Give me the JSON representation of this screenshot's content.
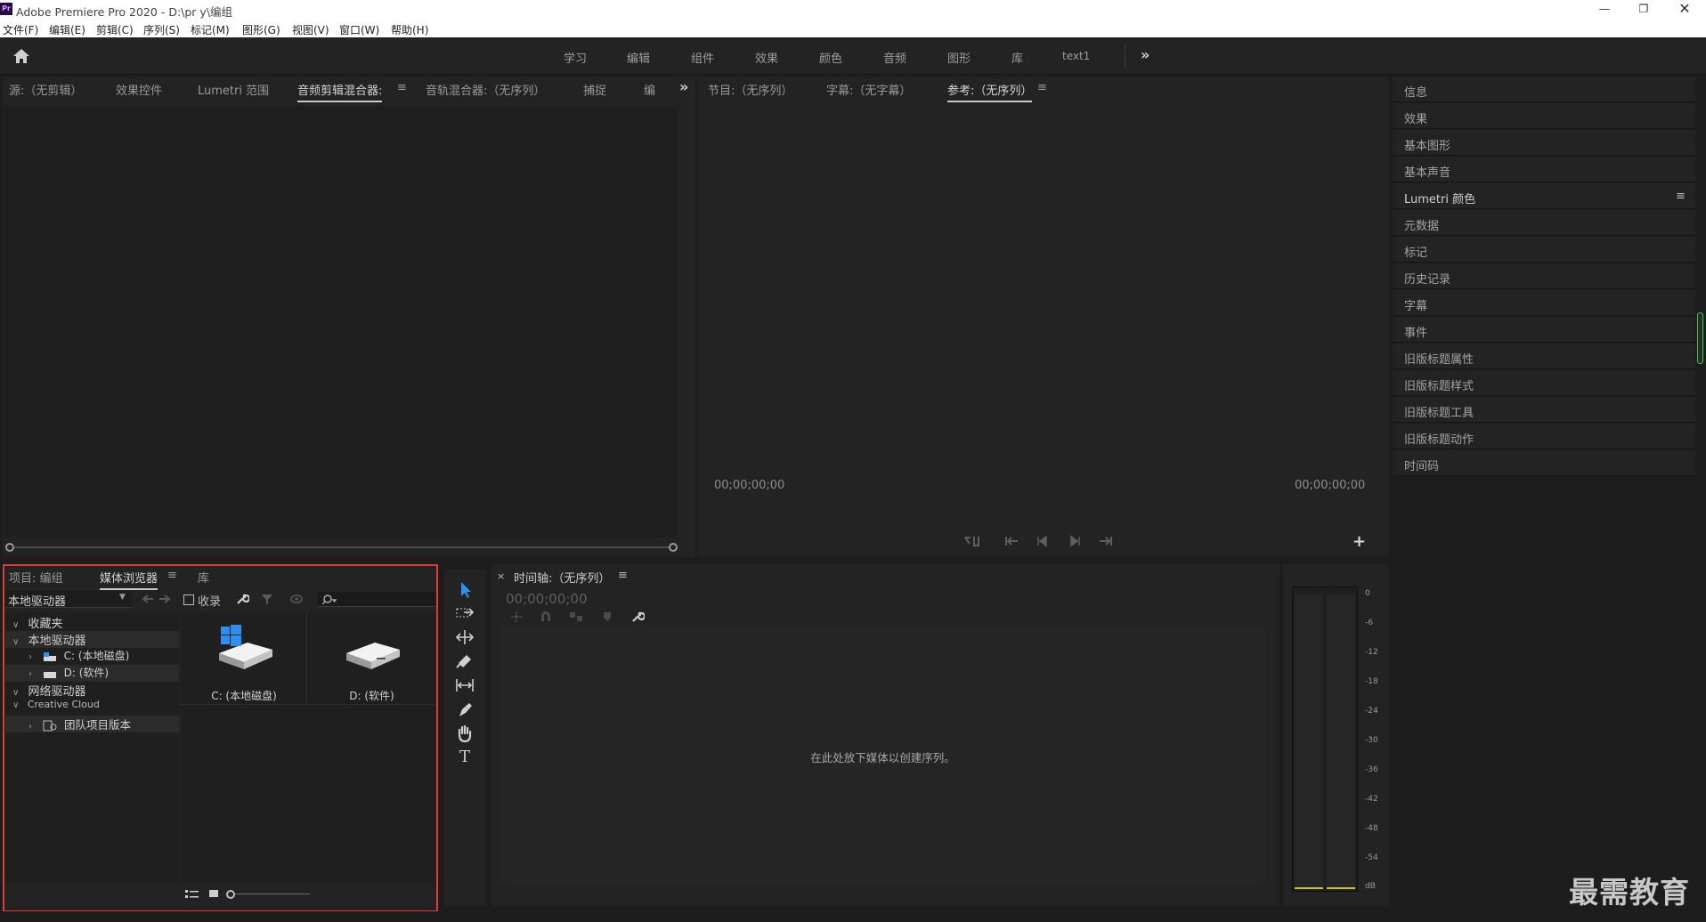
{
  "app": {
    "title": "Adobe Premiere Pro 2020 - D:\\pr y\\编组",
    "logo_text": "Pr"
  },
  "menu": [
    "文件(F)",
    "编辑(E)",
    "剪辑(C)",
    "序列(S)",
    "标记(M)",
    "图形(G)",
    "视图(V)",
    "窗口(W)",
    "帮助(H)"
  ],
  "workspaces": [
    "学习",
    "编辑",
    "组件",
    "效果",
    "颜色",
    "音频",
    "图形",
    "库",
    "text1"
  ],
  "source_panel": {
    "tabs": [
      "源:（无剪辑）",
      "效果控件",
      "Lumetri 范围",
      "音频剪辑混合器:",
      "音轨混合器:（无序列）",
      "捕捉",
      "编"
    ],
    "active_tab_index": 3
  },
  "program_panel": {
    "tabs": [
      "节目:（无序列）",
      "字幕:（无字幕）",
      "参考:（无序列）"
    ],
    "active_tab_index": 2,
    "timecode_left": "00;00;00;00",
    "timecode_right": "00;00;00;00"
  },
  "right_panel": {
    "items": [
      "信息",
      "效果",
      "基本图形",
      "基本声音",
      "Lumetri 颜色",
      "元数据",
      "标记",
      "历史记录",
      "字幕",
      "事件",
      "旧版标题属性",
      "旧版标题样式",
      "旧版标题工具",
      "旧版标题动作",
      "时间码"
    ],
    "menu_item_index": 4
  },
  "project_panel": {
    "tabs": [
      "项目: 编组",
      "媒体浏览器",
      "库"
    ],
    "active_tab_index": 1,
    "drive_select": "本地驱动器",
    "favorites_checkbox": "收录",
    "tree": {
      "favorites": "收藏夹",
      "local_drives": "本地驱动器",
      "drive_c": "C: (本地磁盘)",
      "drive_d": "D: (软件)",
      "network_drives": "网络驱动器",
      "creative_cloud": "Creative Cloud",
      "team_projects": "团队项目版本"
    },
    "thumbnails": [
      "C: (本地磁盘)",
      "D: (软件)"
    ]
  },
  "timeline": {
    "title": "时间轴:（无序列）",
    "timecode": "00;00;00;00",
    "drop_hint": "在此处放下媒体以创建序列。"
  },
  "audio_meter": {
    "scale": [
      "0",
      "-6",
      "-12",
      "-18",
      "-24",
      "-30",
      "-36",
      "-42",
      "-48",
      "-54",
      "dB"
    ]
  },
  "watermark": "最需教育",
  "colors": {
    "accent_blue": "#2f8ff0",
    "highlight_border": "#e03a3a",
    "pr_logo": "#2a0a4a",
    "meter_green": "#3cc84a"
  }
}
